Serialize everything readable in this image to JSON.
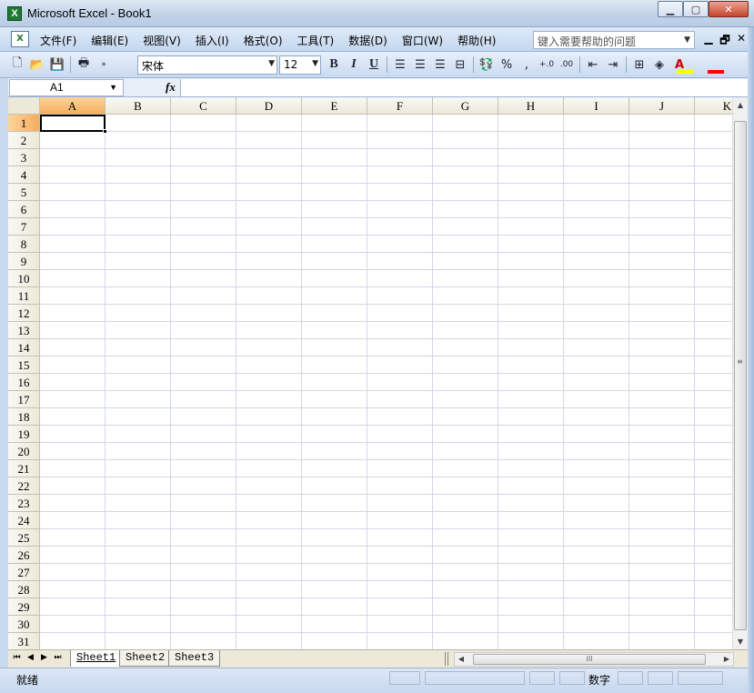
{
  "window": {
    "title": "Microsoft Excel - Book1",
    "app_icon": "excel-icon",
    "controls": [
      "minimize",
      "maximize",
      "close"
    ],
    "close_glyph": "✕",
    "minimize_glyph": "▁",
    "maximize_glyph": "▢"
  },
  "menubar": {
    "items": [
      "文件(F)",
      "编辑(E)",
      "视图(V)",
      "插入(I)",
      "格式(O)",
      "工具(T)",
      "数据(D)",
      "窗口(W)",
      "帮助(H)"
    ],
    "help_placeholder": "键入需要帮助的问题",
    "mdi_minimize": "▁",
    "mdi_restore": "🗗",
    "mdi_close": "✕"
  },
  "toolbar": {
    "font_name": "宋体",
    "font_size": "12",
    "bold_label": "B",
    "italic_label": "I",
    "underline_label": "U",
    "percent_label": "%",
    "comma_label": ",",
    "increase_decimal_label": "+.0",
    "decrease_decimal_label": ".00",
    "fill_color": "#ffff00",
    "font_color": "#ff0000",
    "font_color_label": "A"
  },
  "formula_bar": {
    "name_box": "A1",
    "fx_label": "fx",
    "formula": ""
  },
  "sheet": {
    "columns": [
      "A",
      "B",
      "C",
      "D",
      "E",
      "F",
      "G",
      "H",
      "I",
      "J",
      "K"
    ],
    "rows": [
      "1",
      "2",
      "3",
      "4",
      "5",
      "6",
      "7",
      "8",
      "9",
      "10",
      "11",
      "12",
      "13",
      "14",
      "15",
      "16",
      "17",
      "18",
      "19",
      "20",
      "21",
      "22",
      "23",
      "24",
      "25",
      "26",
      "27",
      "28",
      "29",
      "30",
      "31"
    ],
    "active_cell": "A1",
    "active_column": "A",
    "active_row": "1"
  },
  "tabs": {
    "sheets": [
      "Sheet1",
      "Sheet2",
      "Sheet3"
    ],
    "active_sheet": "Sheet1",
    "hscroll_grip": "III"
  },
  "status": {
    "left": "就绪",
    "num_mode": "数字"
  },
  "colors": {
    "active_header": "#f6ad5f",
    "gridline": "#d0d7e5",
    "title_bar": "#c6d6ea",
    "accent_green": "#1f7a35"
  }
}
